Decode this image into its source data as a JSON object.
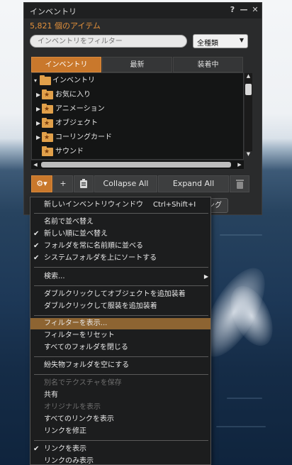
{
  "window": {
    "title": "インベントリ",
    "help_icon": "?",
    "minimize_icon": "—",
    "close_icon": "✕",
    "item_count": "5,821 個のアイテム",
    "filter_placeholder": "インベントリをフィルター",
    "type_select": "全種類"
  },
  "tabs": [
    {
      "label": "インベントリ",
      "active": true
    },
    {
      "label": "最新",
      "active": false
    },
    {
      "label": "装着中",
      "active": false
    }
  ],
  "tree": {
    "root": "インベントリ",
    "items": [
      "お気に入り",
      "アニメーション",
      "オブジェクト",
      "コーリングカード",
      "サウンド"
    ]
  },
  "bottom_bar": {
    "gear_label": "⚙▾",
    "add_label": "+",
    "collapse_label": "Collapse All",
    "expand_label": "Expand All",
    "trash_icon": "trash-icon",
    "wearing_label": "ッピング"
  },
  "menu": {
    "new_window": {
      "label": "新しいインベントリウィンドウ",
      "shortcut": "Ctrl+Shift+I"
    },
    "sort_name": "名前で並べ替え",
    "sort_date": "新しい順に並べ替え",
    "folders_by_name": "フォルダを常に名前順に並べる",
    "system_folders_top": "システムフォルダを上にソートする",
    "search": "検索...",
    "double_click_object": "ダブルクリックしてオブジェクトを追加装着",
    "double_click_clothing": "ダブルクリックして服装を追加装着",
    "show_filters": "フィルターを表示...",
    "reset_filters": "フィルターをリセット",
    "close_all_folders": "すべてのフォルダを閉じる",
    "empty_lost_found": "紛失物フォルダを空にする",
    "save_texture_as": "別名でテクスチャを保存",
    "share": "共有",
    "show_original": "オリジナルを表示",
    "show_all_links": "すべてのリンクを表示",
    "fix_link": "リンクを修正",
    "show_links": "リンクを表示",
    "show_links_only": "リンクのみ表示"
  },
  "colors": {
    "accent": "#c9782c",
    "highlight": "#8d6432",
    "count": "#e4913b"
  }
}
